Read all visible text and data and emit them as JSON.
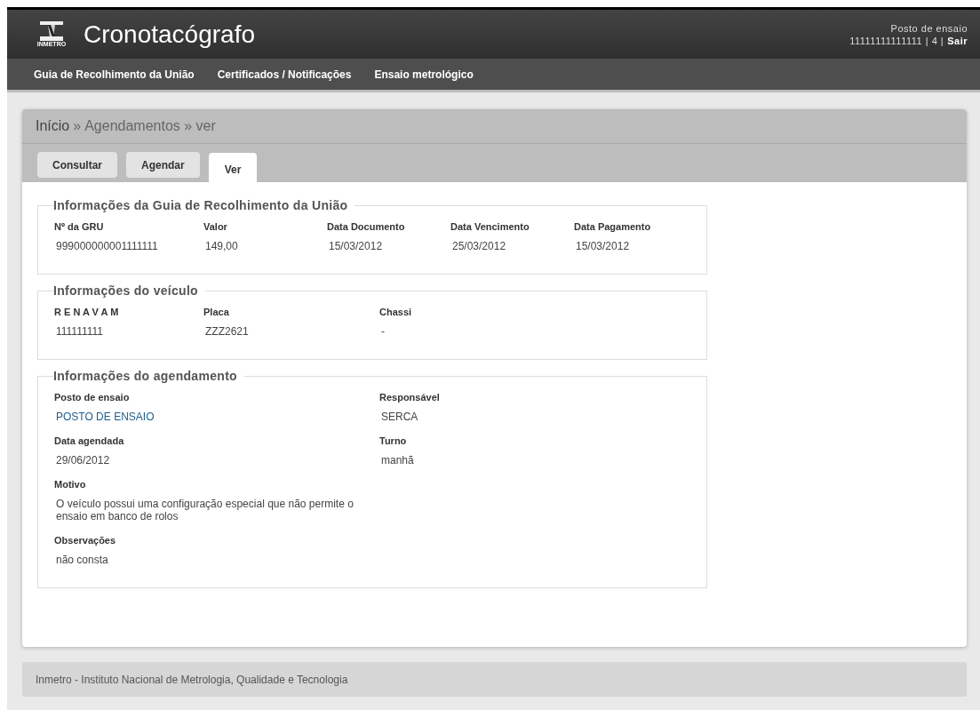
{
  "header": {
    "logo_text": "INMETRO",
    "title": "Cronotacógrafo",
    "user": {
      "role": "Posto de ensaio",
      "info": "11111111111111 | 4 |",
      "logout": "Sair"
    }
  },
  "nav": [
    "Guia de Recolhimento da União",
    "Certificados / Notificações",
    "Ensaio metrológico"
  ],
  "breadcrumb": {
    "home": "Início",
    "separator": "»",
    "trail": "Agendamentos » ver"
  },
  "tabs": [
    {
      "label": "Consultar",
      "selected": false
    },
    {
      "label": "Agendar",
      "selected": false
    },
    {
      "label": "Ver",
      "selected": true
    }
  ],
  "sections": [
    {
      "title": "Informações da Guia de Recolhimento da União",
      "kind": "grid",
      "rows": [
        [
          {
            "label": "Nº da GRU",
            "value": "999000000001111111",
            "link": false
          },
          {
            "label": "Valor",
            "value": "149,00",
            "link": false
          },
          {
            "label": "Data Documento",
            "value": "15/03/2012",
            "link": false
          },
          {
            "label": "Data Vencimento",
            "value": "25/03/2012",
            "link": false
          },
          {
            "label": "Data Pagamento",
            "value": "15/03/2012",
            "link": false
          }
        ]
      ]
    },
    {
      "title": "Informações do veículo",
      "kind": "wide",
      "rows": [
        [
          {
            "label": "R E N A V A M",
            "value": "111111111",
            "link": false
          },
          {
            "label": "Placa",
            "value": "ZZZ2621",
            "link": false
          },
          {
            "label": "Chassi",
            "value": "-",
            "link": false
          }
        ]
      ]
    },
    {
      "title": "Informações do agendamento",
      "kind": "pairs",
      "rows": [
        [
          {
            "label": "Posto de ensaio",
            "value": "POSTO DE ENSAIO",
            "link": true
          },
          {
            "label": "Responsável",
            "value": "SERCA",
            "link": false
          }
        ],
        [
          {
            "label": "Data agendada",
            "value": "29/06/2012",
            "link": false
          },
          {
            "label": "Turno",
            "value": "manhã",
            "link": false
          }
        ],
        [
          {
            "label": "Motivo",
            "value": "O veículo possui uma configuração especial que não permite o ensaio em banco de rolos",
            "link": false
          }
        ],
        [
          {
            "label": "Observações",
            "value": "não consta",
            "link": false
          }
        ]
      ]
    }
  ],
  "footer": "Inmetro - Instituto Nacional de Metrologia, Qualidade e Tecnologia"
}
